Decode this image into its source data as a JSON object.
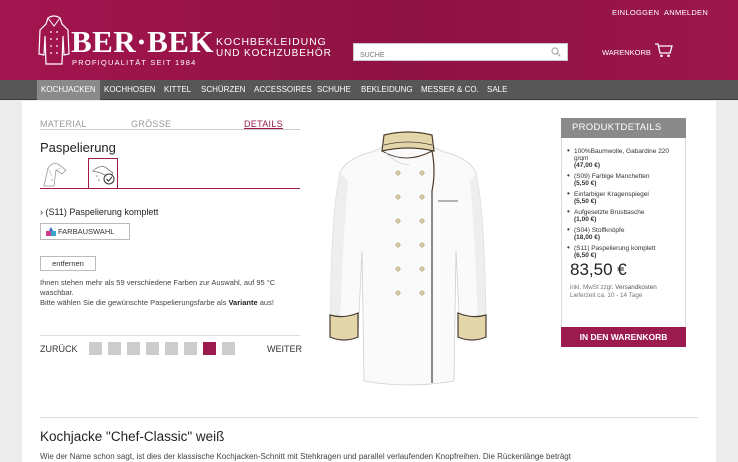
{
  "header": {
    "logo_text": "BER·BEK",
    "logo_sub": "PROFIQUALITÄT SEIT 1984",
    "tagline_1": "KOCHBEKLEIDUNG",
    "tagline_2": "UND KOCHZUBEHÖR",
    "login": "EINLOGGEN",
    "register": "ANMELDEN",
    "search_placeholder": "SUCHE",
    "cart": "WARENKORB"
  },
  "nav": [
    "KOCHJACKEN",
    "KOCHHOSEN",
    "KITTEL",
    "SCHÜRZEN",
    "ACCESSOIRES",
    "SCHUHE",
    "BEKLEIDUNG",
    "MESSER & CO.",
    "SALE"
  ],
  "configurator": {
    "tabs": [
      "MATERIAL",
      "GRÖSSE",
      "DETAILS"
    ],
    "active_tab": "DETAILS",
    "option_title": "Paspelierung",
    "selected_option": "(S11) Paspelierung komplett",
    "color_button": "FARBAUSWAHL",
    "remove_button": "entfernen",
    "info_1": "Ihnen stehen mehr als 59 verschiedene Farben zur Auswahl, auf 95 °C waschbar.",
    "info_2": "Bitte wählen Sie die gewünschte Paspelierungsfarbe als",
    "info_bold": "Variante",
    "info_3": "aus!",
    "back": "ZURÜCK",
    "next": "WEITER",
    "step_count": 8,
    "active_step": 7
  },
  "details": {
    "title": "PRODUKTDETAILS",
    "items": [
      {
        "text": "100%Baumwolle, Gabardine 220 g/qm",
        "price": "(47,00 €)"
      },
      {
        "text": "(S09) Farbige Manchetten",
        "price": "(5,50 €)"
      },
      {
        "text": "Einfarbiger Kragenspiegel",
        "price": "(5,50 €)"
      },
      {
        "text": "Aufgesetzte Brusttasche",
        "price": "(1,00 €)"
      },
      {
        "text": "(S04) Stoffknöpfe",
        "price": "(18,00 €)"
      },
      {
        "text": "(S11) Paspelierung komplett",
        "price": "(6,50 €)"
      }
    ],
    "price": "83,50 €",
    "tax_note": "inkl. MwSt zzgl.",
    "shipping": "Versandkosten",
    "delivery": "Lieferzeit ca. 10 - 14 Tage",
    "buy": "IN DEN WARENKORB"
  },
  "product": {
    "title": "Kochjacke \"Chef-Classic\" weiß",
    "description": "Wie der Name schon sagt, ist dies der klassische Kochjacken-Schnitt mit Stehkragen und parallel verlaufenden Knopfreihen. Die Rückenlänge beträgt"
  },
  "colors": {
    "brand": "#9c1b4f",
    "nav_bg": "#575757",
    "collar": "#e2d6aa",
    "piping": "#4a3b2f"
  }
}
